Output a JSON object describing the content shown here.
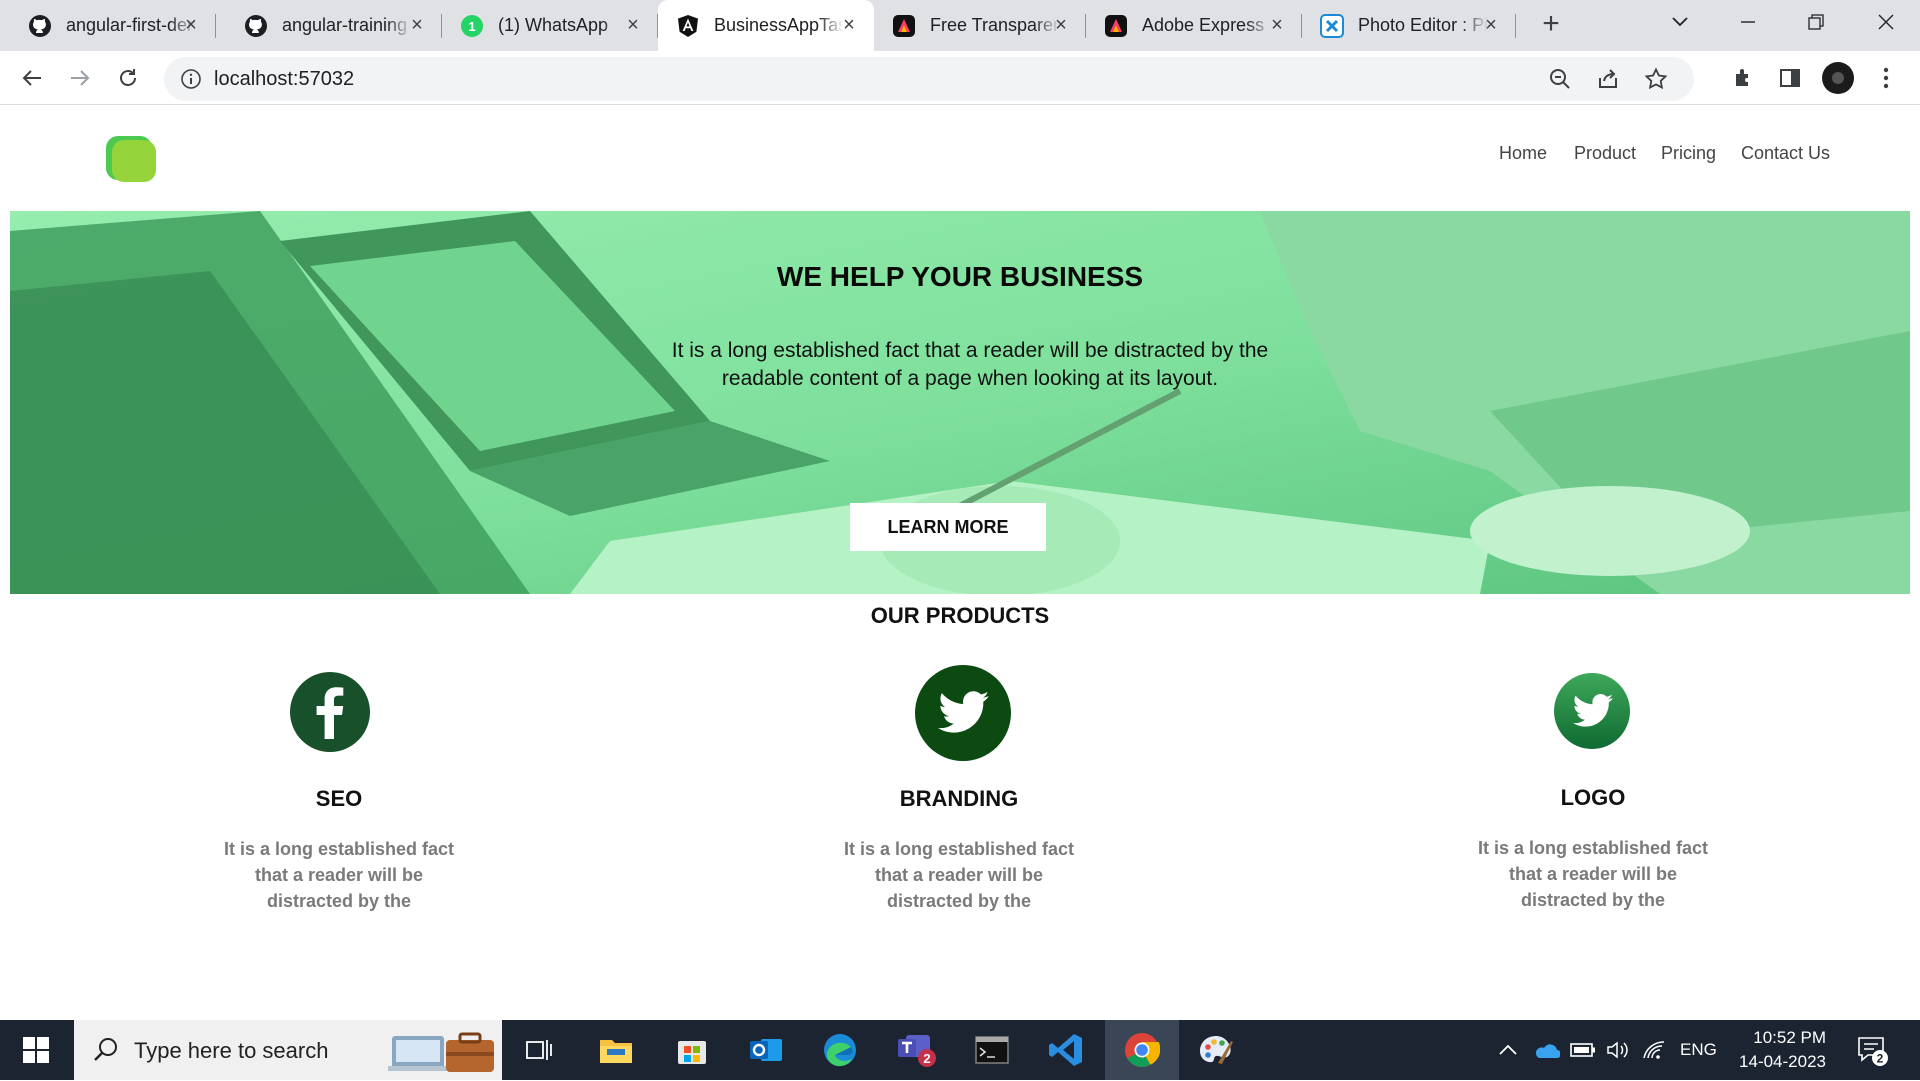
{
  "browser": {
    "tabs": [
      {
        "title": "angular-first-demo",
        "icon": "github-icon"
      },
      {
        "title": "angular-training",
        "icon": "github-icon"
      },
      {
        "title": "(1) WhatsApp",
        "icon": "whatsapp-icon",
        "badge": "1"
      },
      {
        "title": "BusinessAppTask",
        "icon": "angular-icon",
        "active": true
      },
      {
        "title": "Free Transparent",
        "icon": "adobe-express-icon"
      },
      {
        "title": "Adobe Express",
        "icon": "adobe-express-icon"
      },
      {
        "title": "Photo Editor : Pixlr",
        "icon": "photo-editor-icon"
      }
    ],
    "url": "localhost:57032"
  },
  "site": {
    "nav": [
      "Home",
      "Product",
      "Pricing",
      "Contact Us"
    ],
    "hero": {
      "title": "WE HELP YOUR BUSINESS",
      "subtitle": "It is a long established fact that a reader will be distracted by the readable content of a page when looking at its layout.",
      "cta": "LEARN MORE"
    },
    "products_title": "OUR PRODUCTS",
    "products": [
      {
        "name": "SEO",
        "icon": "facebook-icon",
        "desc": "It is a long established fact that a reader will be distracted by the"
      },
      {
        "name": "BRANDING",
        "icon": "twitter-icon",
        "desc": "It is a long established fact that a reader will be distracted by the"
      },
      {
        "name": "LOGO",
        "icon": "twitter-icon",
        "desc": "It is a long established fact that a reader will be distracted by the"
      }
    ]
  },
  "taskbar": {
    "search_placeholder": "Type here to search",
    "language": "ENG",
    "time": "10:52 PM",
    "date": "14-04-2023",
    "teams_badge": "2",
    "notifications_badge": "2"
  },
  "colors": {
    "accent_green": "#0f5a2a",
    "hero_tint": "#6fd08e",
    "logo_green": "#7fd13b"
  }
}
